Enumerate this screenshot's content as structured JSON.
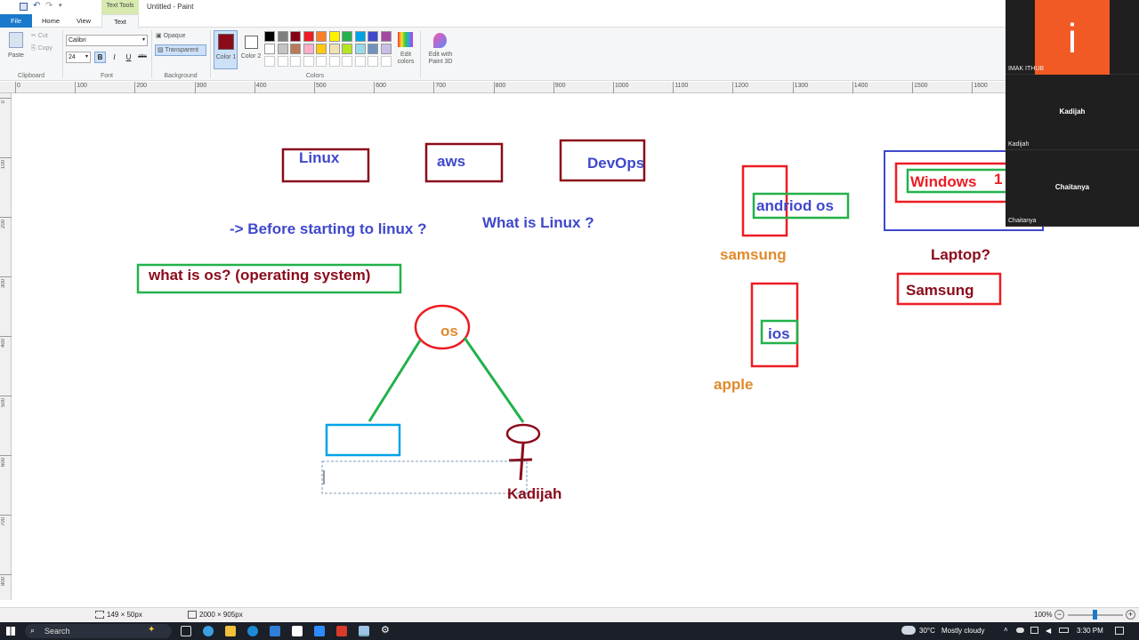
{
  "window": {
    "title": "Untitled - Paint",
    "context_tab_group": "Text Tools"
  },
  "tabs": [
    {
      "label": "File"
    },
    {
      "label": "Home"
    },
    {
      "label": "View"
    },
    {
      "label": "Text"
    }
  ],
  "clipboard": {
    "paste": "Paste",
    "cut": "Cut",
    "copy": "Copy",
    "group_label": "Clipboard"
  },
  "font": {
    "family": "Calibri",
    "size": "24",
    "bold": "B",
    "italic": "I",
    "underline": "U",
    "strike": "abc",
    "group_label": "Font"
  },
  "background": {
    "opaque": "Opaque",
    "transparent": "Transparent",
    "group_label": "Background"
  },
  "colors": {
    "color1_label": "Color 1",
    "color2_label": "Color 2",
    "edit_colors": "Edit colors",
    "paint3d": "Edit with Paint 3D",
    "group_label": "Colors",
    "color1": "#8b0a1a",
    "color2": "#ffffff",
    "palette_row1": [
      "#000000",
      "#7f7f7f",
      "#880015",
      "#ed1c24",
      "#ff7f27",
      "#fff200",
      "#22b14c",
      "#00a2e8",
      "#3f48cc",
      "#a349a4"
    ],
    "palette_row2": [
      "#ffffff",
      "#c3c3c3",
      "#b97a57",
      "#ffaec9",
      "#ffc90e",
      "#efe4b0",
      "#b5e61d",
      "#99d9ea",
      "#7092be",
      "#c8bfe7"
    ]
  },
  "ruler_h": [
    "0",
    "100",
    "200",
    "300",
    "400",
    "500",
    "600",
    "700",
    "800",
    "900",
    "1000",
    "1100",
    "1200",
    "1300",
    "1400",
    "1500",
    "1600"
  ],
  "ruler_v": [
    "0",
    "100",
    "200",
    "300",
    "400",
    "500",
    "600",
    "700",
    "800"
  ],
  "canvas_text": {
    "linux": "Linux",
    "aws": "aws",
    "devops": "DevOps",
    "before": "-> Before starting to linux ?",
    "what_linux": "What is Linux ?",
    "what_os": "what is os? (operating system)",
    "os": "os",
    "kadijah": "Kadijah",
    "android": "andriod os",
    "samsung_small": "samsung",
    "ios": "ios",
    "apple": "apple",
    "windows": "Windows",
    "windows_num": "1",
    "laptop": "Laptop?",
    "samsung_box": "Samsung"
  },
  "status": {
    "selection": "149 × 50px",
    "canvas_size": "2000 × 905px",
    "zoom": "100%"
  },
  "taskbar": {
    "search": "Search",
    "weather_temp": "30°C",
    "weather_desc": "Mostly cloudy",
    "time": "3:30 PM"
  },
  "participants": [
    {
      "name": "IMAK ITHUB",
      "avatar_letter": "i"
    },
    {
      "name": "Kadijah",
      "center_label": "Kadijah"
    },
    {
      "name": "Chaitanya",
      "center_label": "Chaitanya"
    }
  ]
}
